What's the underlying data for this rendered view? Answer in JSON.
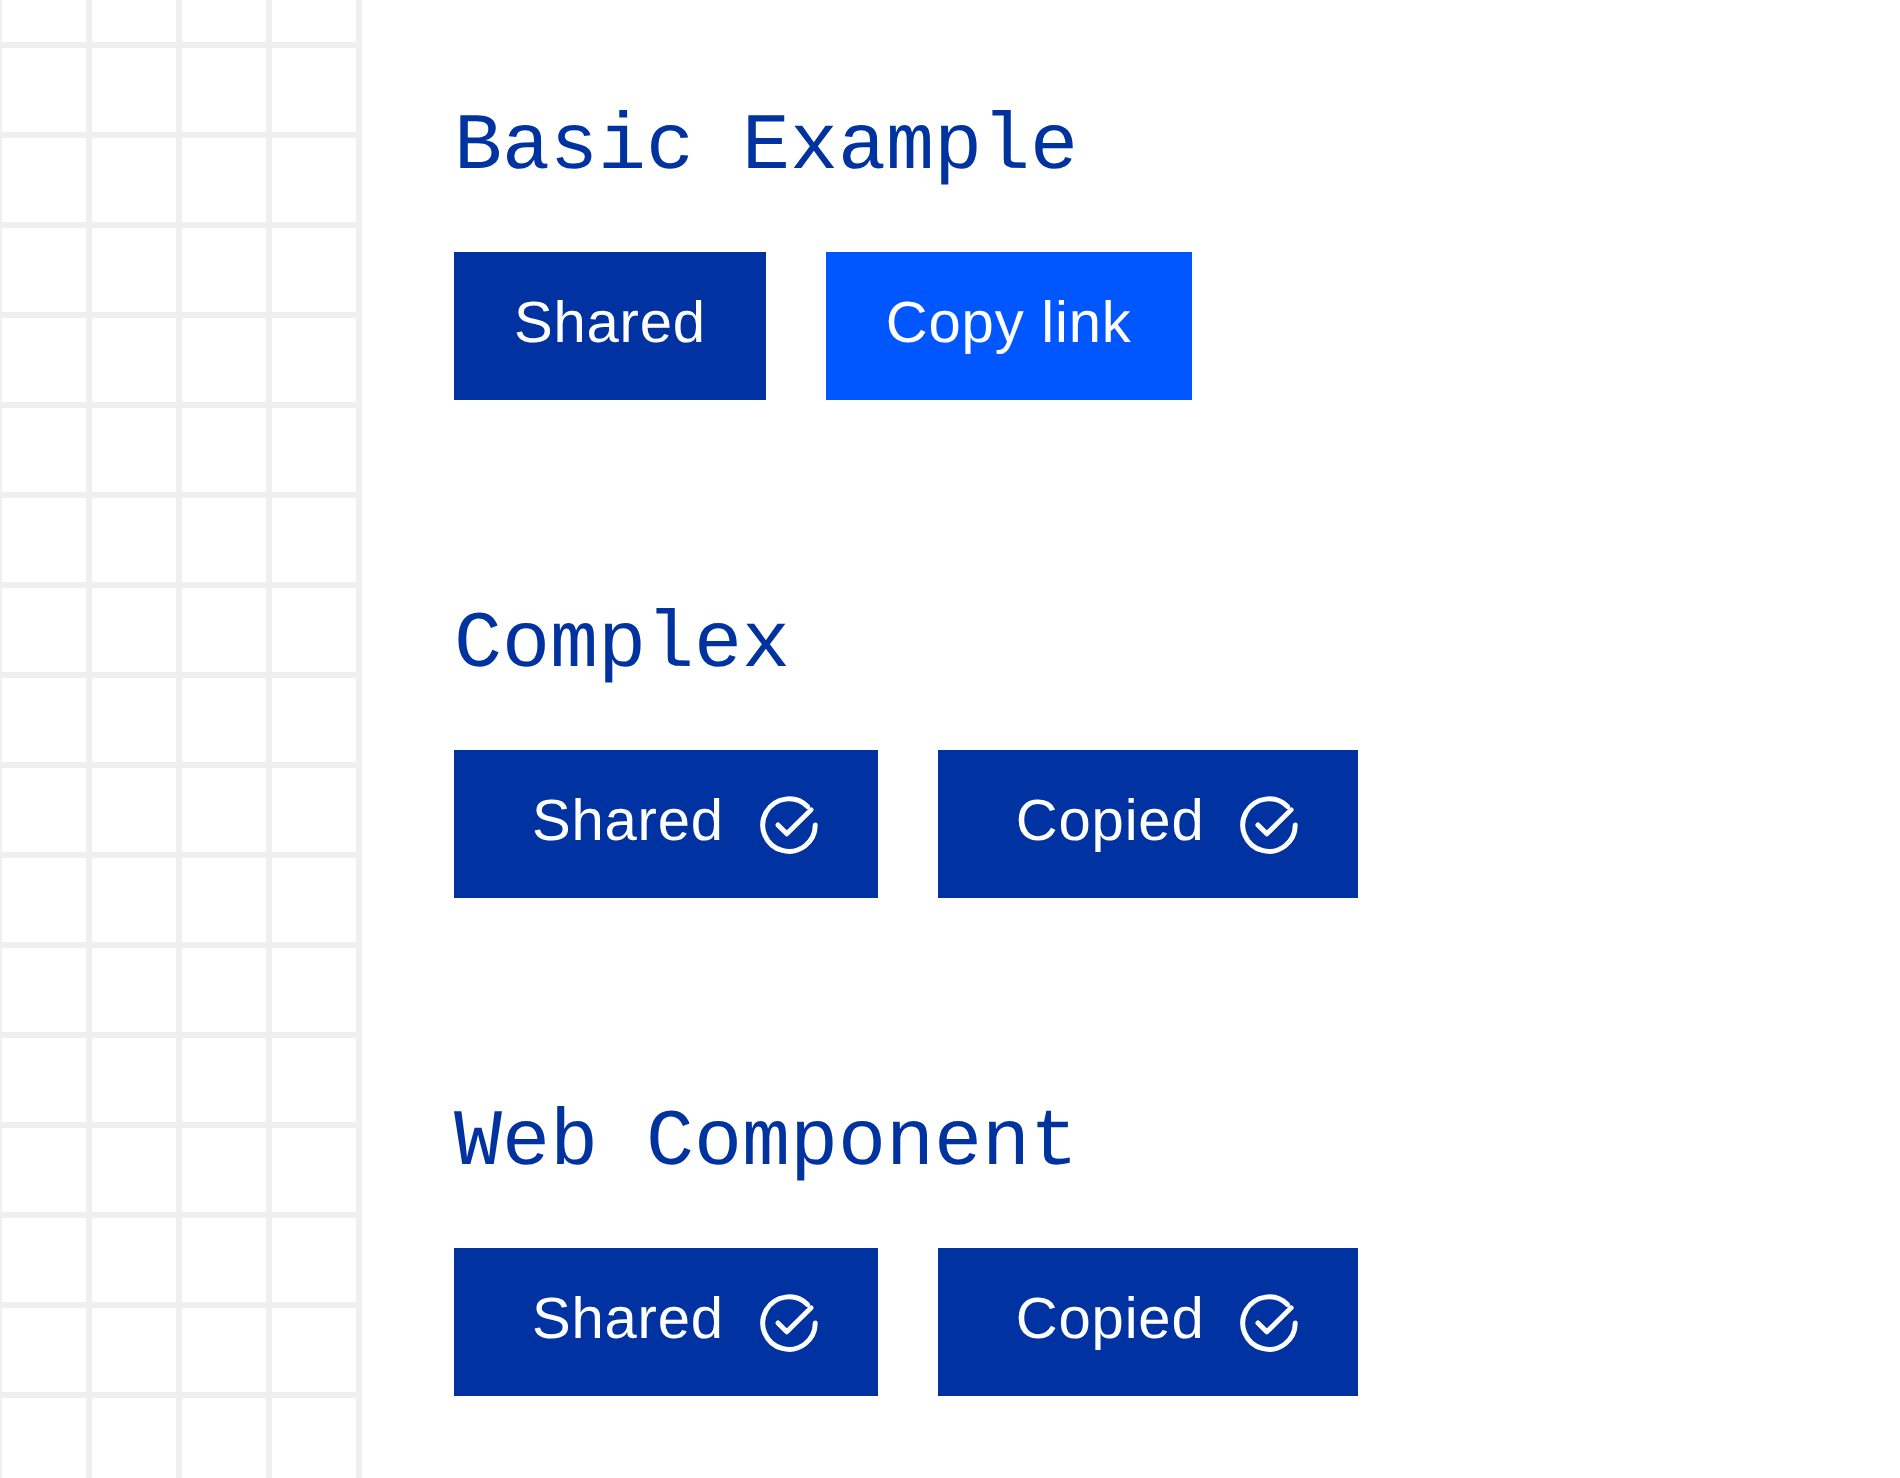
{
  "sections": [
    {
      "title": "Basic Example",
      "buttons": [
        {
          "label": "Shared",
          "kind": "text",
          "copied": true
        },
        {
          "label": "Copy link",
          "kind": "text",
          "copied": false
        }
      ]
    },
    {
      "title": "Complex",
      "buttons": [
        {
          "label": "Shared",
          "kind": "icon",
          "copied": true
        },
        {
          "label": "Copied",
          "kind": "icon",
          "copied": true
        }
      ]
    },
    {
      "title": "Web Component",
      "buttons": [
        {
          "label": "Shared",
          "kind": "icon",
          "copied": true
        },
        {
          "label": "Copied",
          "kind": "icon",
          "copied": true
        }
      ]
    }
  ]
}
